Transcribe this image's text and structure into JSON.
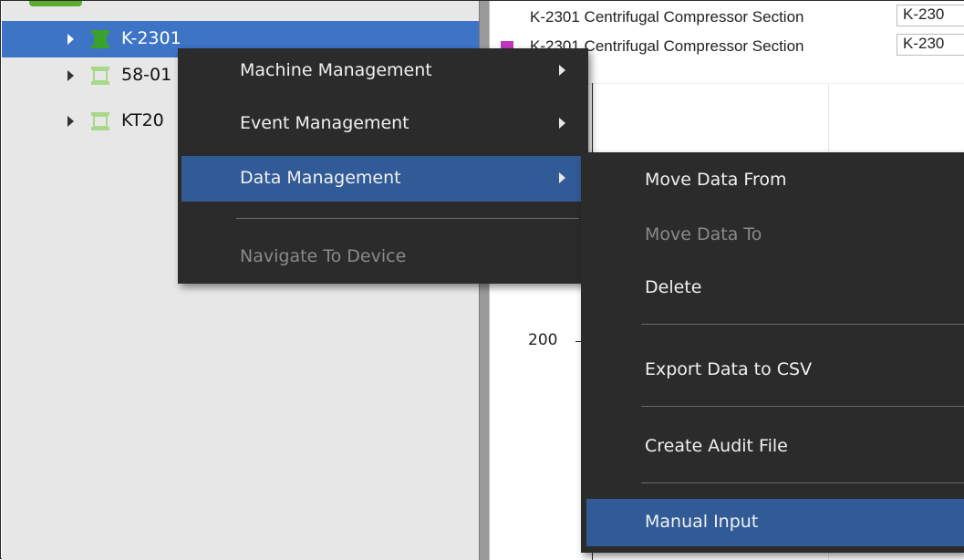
{
  "tree": {
    "items": [
      {
        "label": "K-2301",
        "selected": true,
        "icon": "machine-icon",
        "icon_color": "#3aa12a"
      },
      {
        "label": "58-01",
        "selected": false,
        "icon": "machine-icon",
        "icon_color": "#a8d98a"
      },
      {
        "label": "KT20",
        "selected": false,
        "icon": "machine-icon",
        "icon_color": "#a8d98a"
      }
    ]
  },
  "chart": {
    "legend": [
      {
        "text": "K-2301 Centrifugal Compressor Section",
        "value": "K-230",
        "swatch": false
      },
      {
        "text": "K-2301 Centrifugal Compressor Section",
        "value": "K-230",
        "swatch": true,
        "swatch_color": "#c036c0"
      }
    ],
    "y_tick": "200"
  },
  "context_menu": {
    "items": [
      {
        "label": "Machine Management",
        "submenu": true
      },
      {
        "label": "Event Management",
        "submenu": true
      },
      {
        "label": "Data Management",
        "submenu": true,
        "highlighted": true
      },
      {
        "label": "Navigate To Device",
        "disabled": true
      }
    ]
  },
  "submenu": {
    "items": [
      {
        "label": "Move Data From"
      },
      {
        "label": "Move Data To",
        "disabled": true
      },
      {
        "label": "Delete"
      },
      {
        "label": "Export Data to CSV"
      },
      {
        "label": "Create Audit File"
      },
      {
        "label": "Manual Input",
        "highlighted": true
      }
    ]
  },
  "colors": {
    "selection": "#3d74c6",
    "menu_bg": "#2b2b2b",
    "menu_highlight": "#315b96"
  }
}
